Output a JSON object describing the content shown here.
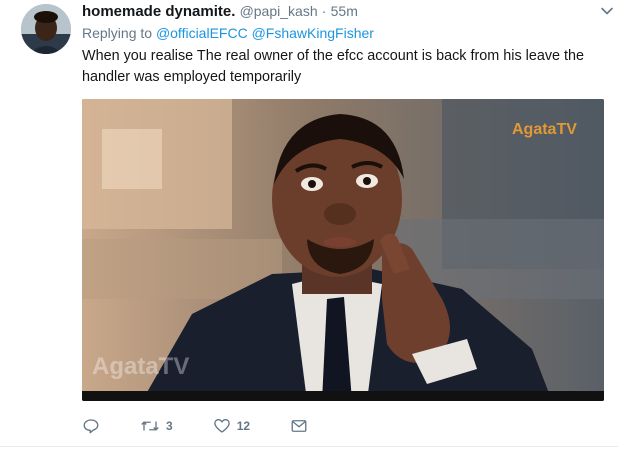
{
  "tweet": {
    "display_name": "homemade dynamite.",
    "handle": "@papi_kash",
    "separator": "·",
    "time": "55m",
    "replying_prefix": "Replying to",
    "mentions": [
      "@officialEFCC",
      "@FshawKingFisher"
    ],
    "text": "When you realise The real owner of the efcc account is back from his leave the handler was employed temporarily",
    "media": {
      "watermark_top": "AgataTV",
      "watermark_bottom": "AgataTV"
    },
    "actions": {
      "reply_icon": "reply-icon",
      "retweet_icon": "retweet-icon",
      "retweet_count": "3",
      "like_icon": "heart-icon",
      "like_count": "12",
      "dm_icon": "envelope-icon"
    }
  },
  "colors": {
    "link": "#1b95e0",
    "muted": "#657786",
    "text": "#14171a"
  }
}
